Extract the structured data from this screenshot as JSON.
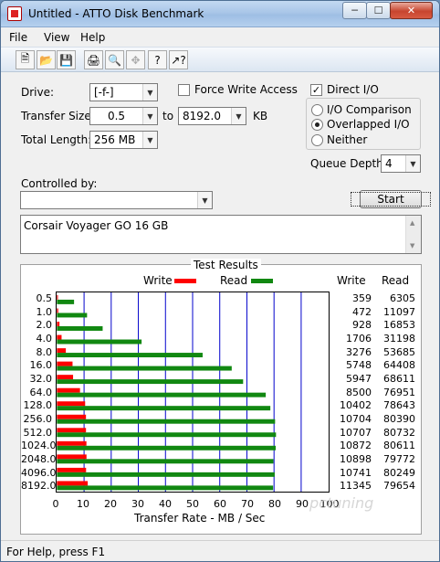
{
  "window": {
    "title": "Untitled - ATTO Disk Benchmark",
    "min": "─",
    "max": "☐",
    "close": "✕"
  },
  "menu": [
    "File",
    "View",
    "Help"
  ],
  "toolbar_icons": [
    "new-icon",
    "open-icon",
    "save-icon",
    "print-icon",
    "print-preview-icon",
    "move-icon",
    "help-icon",
    "context-help-icon"
  ],
  "form": {
    "drive_label": "Drive:",
    "drive_value": "[-f-]",
    "force_write_label": "Force Write Access",
    "force_write_checked": false,
    "direct_io_label": "Direct I/O",
    "direct_io_checked": true,
    "transfer_size_label": "Transfer Size:",
    "transfer_from": "0.5",
    "to_label": "to",
    "transfer_to": "8192.0",
    "kb_label": "KB",
    "total_length_label": "Total Length:",
    "total_length_value": "256 MB",
    "io_comparison_label": "I/O Comparison",
    "overlapped_io_label": "Overlapped I/O",
    "neither_label": "Neither",
    "selected_mode": "Overlapped I/O",
    "queue_depth_label": "Queue Depth:",
    "queue_depth_value": "4",
    "controlled_by_label": "Controlled by:",
    "controlled_by_value": "",
    "start_label": "Start",
    "description": "Corsair Voyager GO 16 GB"
  },
  "results": {
    "title": "Test Results",
    "legend_write": "Write",
    "legend_read": "Read",
    "col_write": "Write",
    "col_read": "Read",
    "xlabel": "Transfer Rate - MB / Sec",
    "colors": {
      "write": "#ff0000",
      "read": "#118811",
      "grid": "#0000cc"
    }
  },
  "chart_data": {
    "type": "bar",
    "orientation": "horizontal",
    "title": "Test Results",
    "xlabel": "Transfer Rate - MB / Sec",
    "xlim": [
      0,
      100
    ],
    "xticks": [
      0,
      10,
      20,
      30,
      40,
      50,
      60,
      70,
      80,
      90,
      100
    ],
    "categories": [
      "0.5",
      "1.0",
      "2.0",
      "4.0",
      "8.0",
      "16.0",
      "32.0",
      "64.0",
      "128.0",
      "256.0",
      "512.0",
      "1024.0",
      "2048.0",
      "4096.0",
      "8192.0"
    ],
    "series": [
      {
        "name": "Write",
        "values_mb_s": [
          0.36,
          0.47,
          0.93,
          1.71,
          3.28,
          5.75,
          5.95,
          8.5,
          10.4,
          10.7,
          10.71,
          10.87,
          10.9,
          10.74,
          11.35
        ],
        "printed": [
          "359",
          "472",
          "928",
          "1706",
          "3276",
          "5748",
          "5947",
          "8500",
          "10402",
          "10704",
          "10707",
          "10872",
          "10898",
          "10741",
          "11345"
        ]
      },
      {
        "name": "Read",
        "values_mb_s": [
          6.31,
          11.1,
          16.85,
          31.2,
          53.69,
          64.41,
          68.61,
          76.95,
          78.64,
          80.39,
          80.73,
          80.61,
          79.77,
          80.25,
          79.65
        ],
        "printed": [
          "6305",
          "11097",
          "16853",
          "31198",
          "53685",
          "64408",
          "68611",
          "76951",
          "78643",
          "80390",
          "80732",
          "80611",
          "79772",
          "80249",
          "79654"
        ]
      }
    ],
    "legend": "top-center",
    "grid": true
  },
  "watermark": "pctuning",
  "status": "For Help, press F1"
}
